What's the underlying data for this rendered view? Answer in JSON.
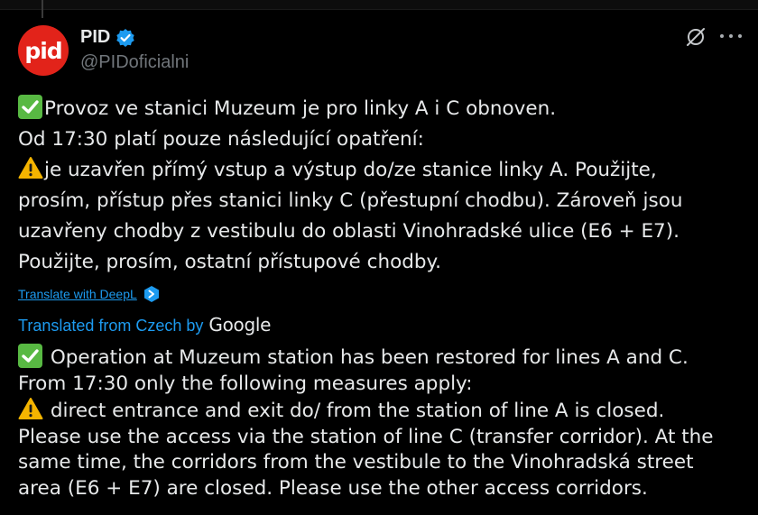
{
  "author": {
    "avatar_text": "pid",
    "display_name": "PID",
    "handle": "@PIDoficialni",
    "brand_color": "#e2231a",
    "verified_color": "#1d9bf0"
  },
  "icons": {
    "verified": "verified-badge-icon",
    "hide": "slashed-circle-icon",
    "more": "more-dots-icon",
    "check": "check-mark-emoji",
    "warning": "warning-emoji",
    "deepl": "deepl-icon"
  },
  "original": {
    "line1": "Provoz ve stanici Muzeum je pro linky A i C obnoven.",
    "line2": "Od 17:30 platí pouze následující opatření:",
    "line3": "je uzavřen přímý vstup a výstup do/ze stanice linky A. Použijte,",
    "line4": "prosím, přístup přes stanici linky C (přestupní chodbu). Zároveň jsou",
    "line5": "uzavřeny chodby z vestibulu do oblasti Vinohradské ulice (E6 + E7).",
    "line6": "Použijte, prosím, ostatní přístupové chodby."
  },
  "deepl_label": "Translate with DeepL",
  "translated_from": "Translated from Czech by",
  "google_label": "Google",
  "translation": {
    "line1": " Operation at Muzeum station has been restored for lines A and C.",
    "line2": "From 17:30 only the following measures apply:",
    "line3": " direct entrance and exit do/ from the station of line A is closed.",
    "line4": "Please use the access via the station of line C (transfer corridor). At the",
    "line5": "same time, the corridors from the vestibule to the Vinohradská street",
    "line6": "area (E6 + E7) are closed. Please use the other access corridors."
  }
}
